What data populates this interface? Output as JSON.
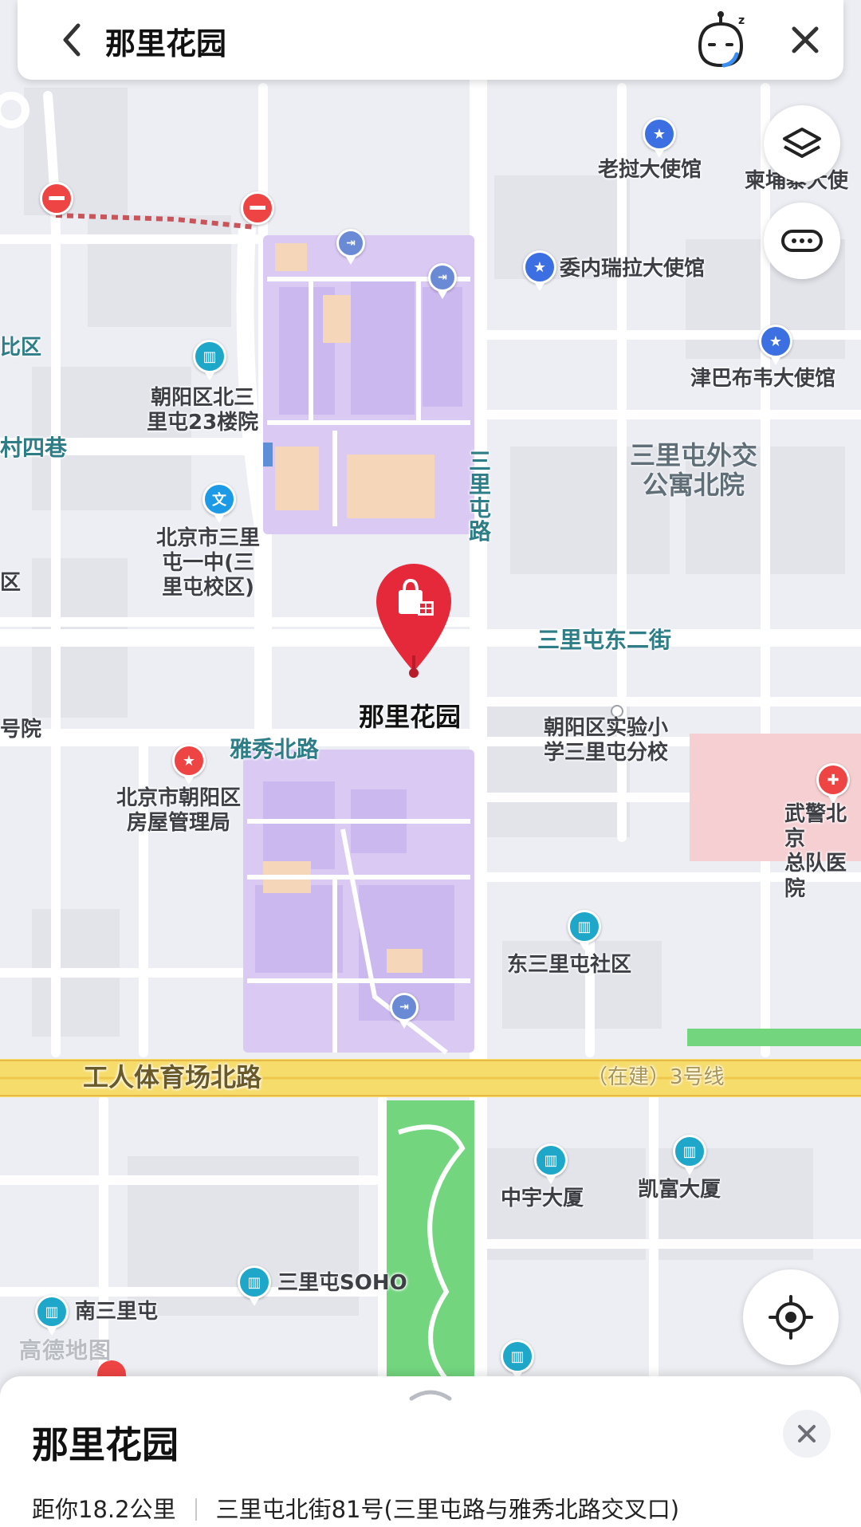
{
  "search_bar": {
    "title": "那里花园",
    "back_icon": "chevron-left-icon",
    "assistant_icon": "assistant-mascot-icon",
    "close_icon": "close-icon"
  },
  "map": {
    "roads": {
      "gongti_north": "工人体育场北路",
      "metro_line": "（在建）3号线",
      "sanlitun_road": "三里屯路",
      "sanlitun_east2": "三里屯东二街",
      "yaxiu_north": "雅秀北路",
      "cun_sixiang": "村四巷"
    },
    "areas": {
      "waijiao_north": "三里屯外交\n公寓北院"
    },
    "pois": {
      "laos_embassy": "老挝大使馆",
      "cambodia_embassy": "柬埔寨大使",
      "venezuela_embassy": "委内瑞拉大使馆",
      "zimbabwe_embassy": "津巴布韦大使馆",
      "north_sanlitun_23": "朝阳区北三\n里屯23楼院",
      "sanlitun_school": "北京市三里\n屯一中(三\n里屯校区)",
      "selected_place": "那里花园",
      "experimental_school": "朝阳区实验小\n学三里屯分校",
      "housing_bureau": "北京市朝阳区\n房屋管理局",
      "armed_police": "武警北京\n总队医院",
      "east_sanlitun": "东三里屯社区",
      "zhongyu_building": "中宇大厦",
      "kaifu_building": "凯富大厦",
      "sanlitun_soho": "三里屯SOHO",
      "south_sanlitun": "南三里屯",
      "edge_qu_1": "比区",
      "edge_qu_2": "区",
      "edge_hao": "号院"
    },
    "brand": "高德地图",
    "colors": {
      "mall_area": "#d9c9f3",
      "road_yellow": "#f6dc6b",
      "park_green": "#73d67f",
      "hospital_pink": "#f6cfd2",
      "marker_red": "#e5283a"
    }
  },
  "controls": {
    "layers_icon": "layers-icon",
    "more_icon": "more-icon",
    "locate_icon": "locate-icon"
  },
  "place_card": {
    "title": "那里花园",
    "distance": "距你18.2公里",
    "address": "三里屯北街81号(三里屯路与雅秀北路交叉口)",
    "close_icon": "close-icon",
    "handle_icon": "chevron-up-icon"
  }
}
